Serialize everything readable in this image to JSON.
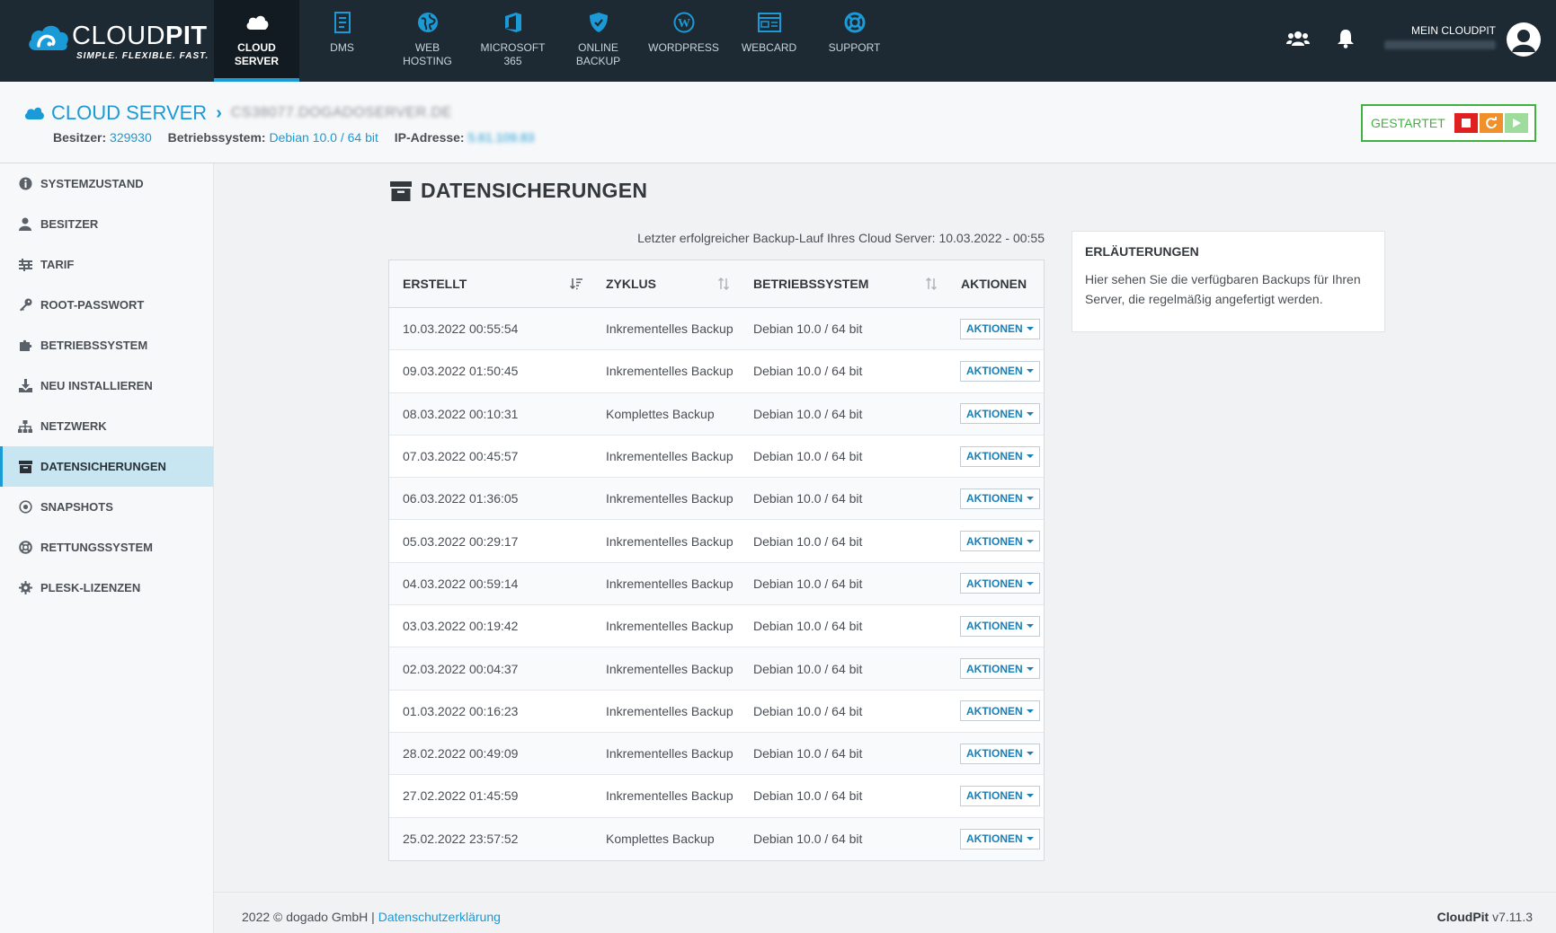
{
  "brand": {
    "name_light": "CLOUD",
    "name_bold": "PIT",
    "tagline": "SIMPLE. FLEXIBLE. FAST."
  },
  "nav": [
    {
      "label": "CLOUD\nSERVER",
      "icon": "cloud-icon",
      "active": true
    },
    {
      "label": "DMS",
      "icon": "document-icon"
    },
    {
      "label": "WEB\nHOSTING",
      "icon": "globe-icon"
    },
    {
      "label": "MICROSOFT 365",
      "icon": "office-icon"
    },
    {
      "label": "ONLINE\nBACKUP",
      "icon": "shield-icon"
    },
    {
      "label": "WORDPRESS",
      "icon": "wordpress-icon"
    },
    {
      "label": "WEBCARD",
      "icon": "webcard-icon"
    },
    {
      "label": "SUPPORT",
      "icon": "lifebuoy-icon"
    }
  ],
  "user": {
    "title": "MEIN CLOUDPIT",
    "email_blurred": "f.heinrich@cloudxkom..."
  },
  "header": {
    "section": "CLOUD SERVER",
    "server_name": "CS38077.DOGADOSERVER.DE",
    "owner_label": "Besitzer:",
    "owner_value": "329930",
    "os_label": "Betriebssystem:",
    "os_value": "Debian 10.0 / 64 bit",
    "ip_label": "IP-Adresse:",
    "ip_value": "5.61.109.83",
    "status": "GESTARTET"
  },
  "sidebar": [
    {
      "label": "SYSTEMZUSTAND",
      "icon": "info-icon"
    },
    {
      "label": "BESITZER",
      "icon": "user-icon"
    },
    {
      "label": "TARIF",
      "icon": "sliders-icon"
    },
    {
      "label": "ROOT-PASSWORT",
      "icon": "key-icon"
    },
    {
      "label": "BETRIEBSSYSTEM",
      "icon": "puzzle-icon"
    },
    {
      "label": "NEU INSTALLIEREN",
      "icon": "download-icon"
    },
    {
      "label": "NETZWERK",
      "icon": "sitemap-icon"
    },
    {
      "label": "DATENSICHERUNGEN",
      "icon": "archive-icon",
      "active": true
    },
    {
      "label": "SNAPSHOTS",
      "icon": "dot-circle-icon"
    },
    {
      "label": "RETTUNGSSYSTEM",
      "icon": "lifebuoy-icon"
    },
    {
      "label": "PLESK-LIZENZEN",
      "icon": "gear-icon"
    }
  ],
  "main": {
    "title": "DATENSICHERUNGEN",
    "last_backup": "Letzter erfolgreicher Backup-Lauf Ihres Cloud Server: 10.03.2022 - 00:55",
    "columns": [
      "ERSTELLT",
      "ZYKLUS",
      "BETRIEBSSYSTEM",
      "AKTIONEN"
    ],
    "action_label": "AKTIONEN",
    "rows": [
      [
        "10.03.2022 00:55:54",
        "Inkrementelles Backup",
        "Debian 10.0 / 64 bit"
      ],
      [
        "09.03.2022 01:50:45",
        "Inkrementelles Backup",
        "Debian 10.0 / 64 bit"
      ],
      [
        "08.03.2022 00:10:31",
        "Komplettes Backup",
        "Debian 10.0 / 64 bit"
      ],
      [
        "07.03.2022 00:45:57",
        "Inkrementelles Backup",
        "Debian 10.0 / 64 bit"
      ],
      [
        "06.03.2022 01:36:05",
        "Inkrementelles Backup",
        "Debian 10.0 / 64 bit"
      ],
      [
        "05.03.2022 00:29:17",
        "Inkrementelles Backup",
        "Debian 10.0 / 64 bit"
      ],
      [
        "04.03.2022 00:59:14",
        "Inkrementelles Backup",
        "Debian 10.0 / 64 bit"
      ],
      [
        "03.03.2022 00:19:42",
        "Inkrementelles Backup",
        "Debian 10.0 / 64 bit"
      ],
      [
        "02.03.2022 00:04:37",
        "Inkrementelles Backup",
        "Debian 10.0 / 64 bit"
      ],
      [
        "01.03.2022 00:16:23",
        "Inkrementelles Backup",
        "Debian 10.0 / 64 bit"
      ],
      [
        "28.02.2022 00:49:09",
        "Inkrementelles Backup",
        "Debian 10.0 / 64 bit"
      ],
      [
        "27.02.2022 01:45:59",
        "Inkrementelles Backup",
        "Debian 10.0 / 64 bit"
      ],
      [
        "25.02.2022 23:57:52",
        "Komplettes Backup",
        "Debian 10.0 / 64 bit"
      ]
    ]
  },
  "info": {
    "title": "ERLÄUTERUNGEN",
    "text": "Hier sehen Sie die verfügbaren Backups für Ihren Server, die regelmäßig angefertigt werden."
  },
  "footer": {
    "copyright": "2022 © dogado GmbH | ",
    "privacy_link": "Datenschutzerklärung",
    "app_name": "CloudPit",
    "version": " v7.11.3"
  },
  "colors": {
    "accent": "#1a9ad6",
    "topbar": "#1e2a33",
    "status_ok": "#3fb23f",
    "stop": "#e02020",
    "restart": "#f0902a",
    "play": "#9edc9e"
  }
}
